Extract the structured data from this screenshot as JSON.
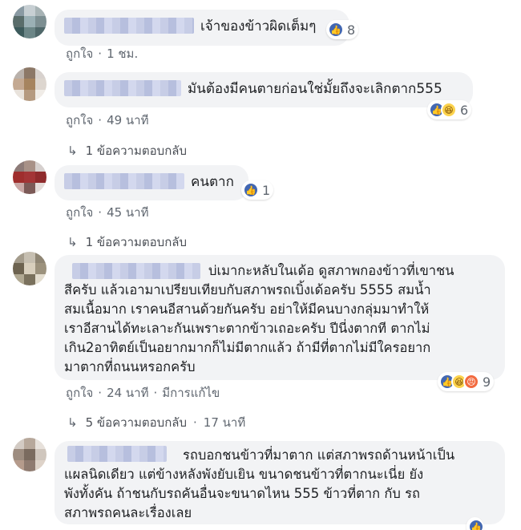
{
  "comments": [
    {
      "text": "เจ้าของข้าวผิดเต็มๆ",
      "react_count": "8",
      "like_label": "ถูกใจ",
      "time": "1 ชม."
    },
    {
      "text": "มันต้องมีคนตายก่อนใช่มั้ยถึงจะเลิกตาก555",
      "react_count": "6",
      "like_label": "ถูกใจ",
      "time": "49 นาที",
      "replies": "1 ข้อความตอบกลับ"
    },
    {
      "text": "คนตาก",
      "react_count": "1",
      "like_label": "ถูกใจ",
      "time": "45 นาที",
      "replies": "1 ข้อความตอบกลับ"
    },
    {
      "lines": [
        "บ่เมากะหลับในเด้อ ดูสภาพกองข้าวที่เขาชน",
        "สีครับ แล้วเอามาเปรียบเทียบกับสภาพรถเบิ้งเด้อครับ 5555 สมน้ำ",
        "สมเนื้อมาก เราคนอีสานด้วยกันครับ อย่าให้มีคนบางกลุ่มมาทำให้",
        "เราอีสานได้ทะเลาะกันเพราะตากข้าวเถอะครับ ปีนี่งตากที ตากไม่",
        "เกิน2อาทิตย์เป็นอยากมากก็ไม่มีตากแล้ว ถ้ามีที่ตากไม่มีใครอยาก",
        "มาตากที่ถนนหรอกครับ"
      ],
      "react_count": "9",
      "like_label": "ถูกใจ",
      "time": "24 นาที",
      "edited_label": "มีการแก้ไข",
      "replies": "5 ข้อความตอบกลับ",
      "reply_time": "17 นาที"
    },
    {
      "lines": [
        "รถบอกชนข้าวที่มาตาก แต่สภาพรถด้านหน้าเป็น",
        "แผลนิดเดียว แต่ข้างหลังพังยับเยิน ขนาดชนข้าวที่ตากนะเนี่ย ยัง",
        "พังทั้งคัน ถ้าชนกับรถคันอื่นจะขนาดไหน 555 ข้าวที่ตาก กับ รถ",
        "สภาพรถคนละเรื่องเลย"
      ]
    }
  ],
  "separator": "·",
  "icons": {
    "like": "like-icon",
    "haha": "haha-icon",
    "angry": "angry-icon",
    "reply_arrow": "reply-arrow-icon"
  },
  "colors": {
    "like_blue": "#4267b2",
    "bubble_bg": "#f2f3f5",
    "meta_gray": "#606770"
  }
}
